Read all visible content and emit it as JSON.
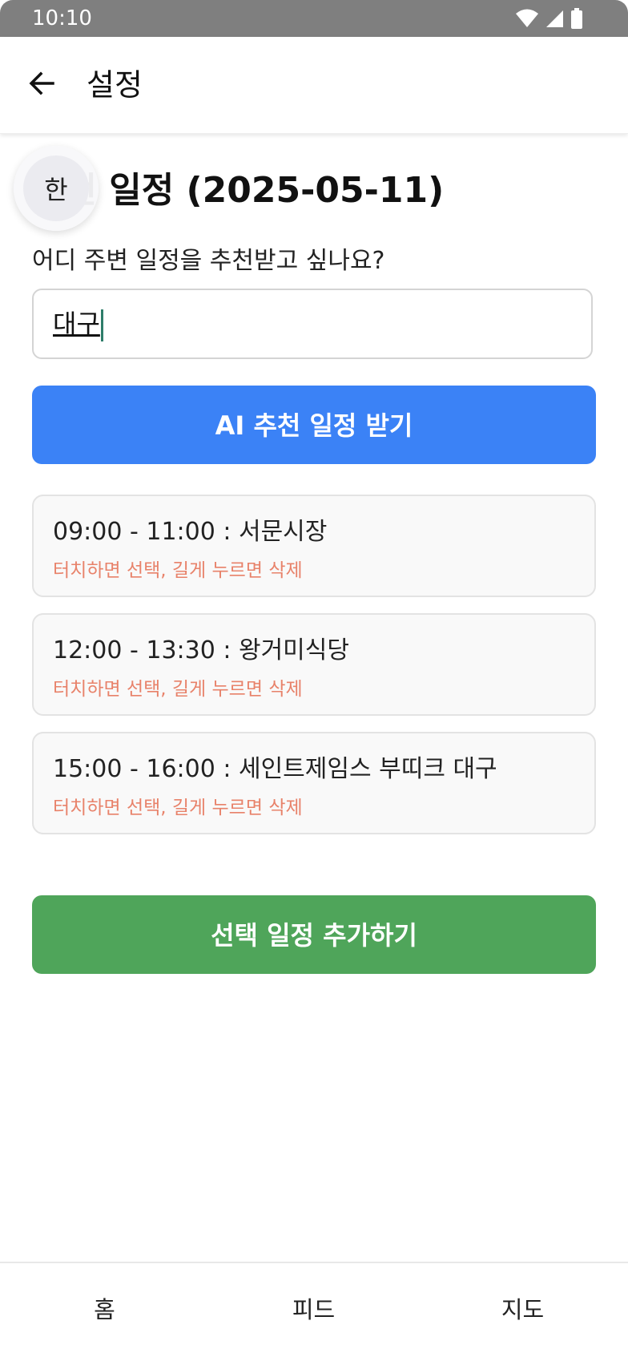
{
  "status_bar": {
    "time": "10:10",
    "icons": [
      "wifi-icon",
      "signal-icon",
      "battery-icon"
    ]
  },
  "app_bar": {
    "back_icon": "arrow-left-icon",
    "title": "설정"
  },
  "ime_indicator": {
    "label": "한"
  },
  "main": {
    "heading": "추천 일정 (2025-05-11)",
    "question": "어디 주변 일정을 추천받고 싶나요?",
    "location_input": {
      "value": "대구",
      "placeholder": ""
    },
    "ai_button_label": "AI 추천 일정 받기",
    "schedules": [
      {
        "title": "09:00 - 11:00 : 서문시장",
        "hint": "터치하면 선택, 길게 누르면 삭제"
      },
      {
        "title": "12:00 - 13:30 : 왕거미식당",
        "hint": "터치하면 선택, 길게 누르면 삭제"
      },
      {
        "title": "15:00 - 16:00 : 세인트제임스 부띠크 대구",
        "hint": "터치하면 선택, 길게 누르면 삭제"
      }
    ],
    "add_button_label": "선택 일정 추가하기"
  },
  "bottom_nav": {
    "items": [
      {
        "label": "홈"
      },
      {
        "label": "피드"
      },
      {
        "label": "지도"
      }
    ]
  },
  "colors": {
    "ai_button": "#3b82f6",
    "add_button": "#4fa55a",
    "hint_text": "#e8826a",
    "status_bar": "#7f7f7f"
  }
}
